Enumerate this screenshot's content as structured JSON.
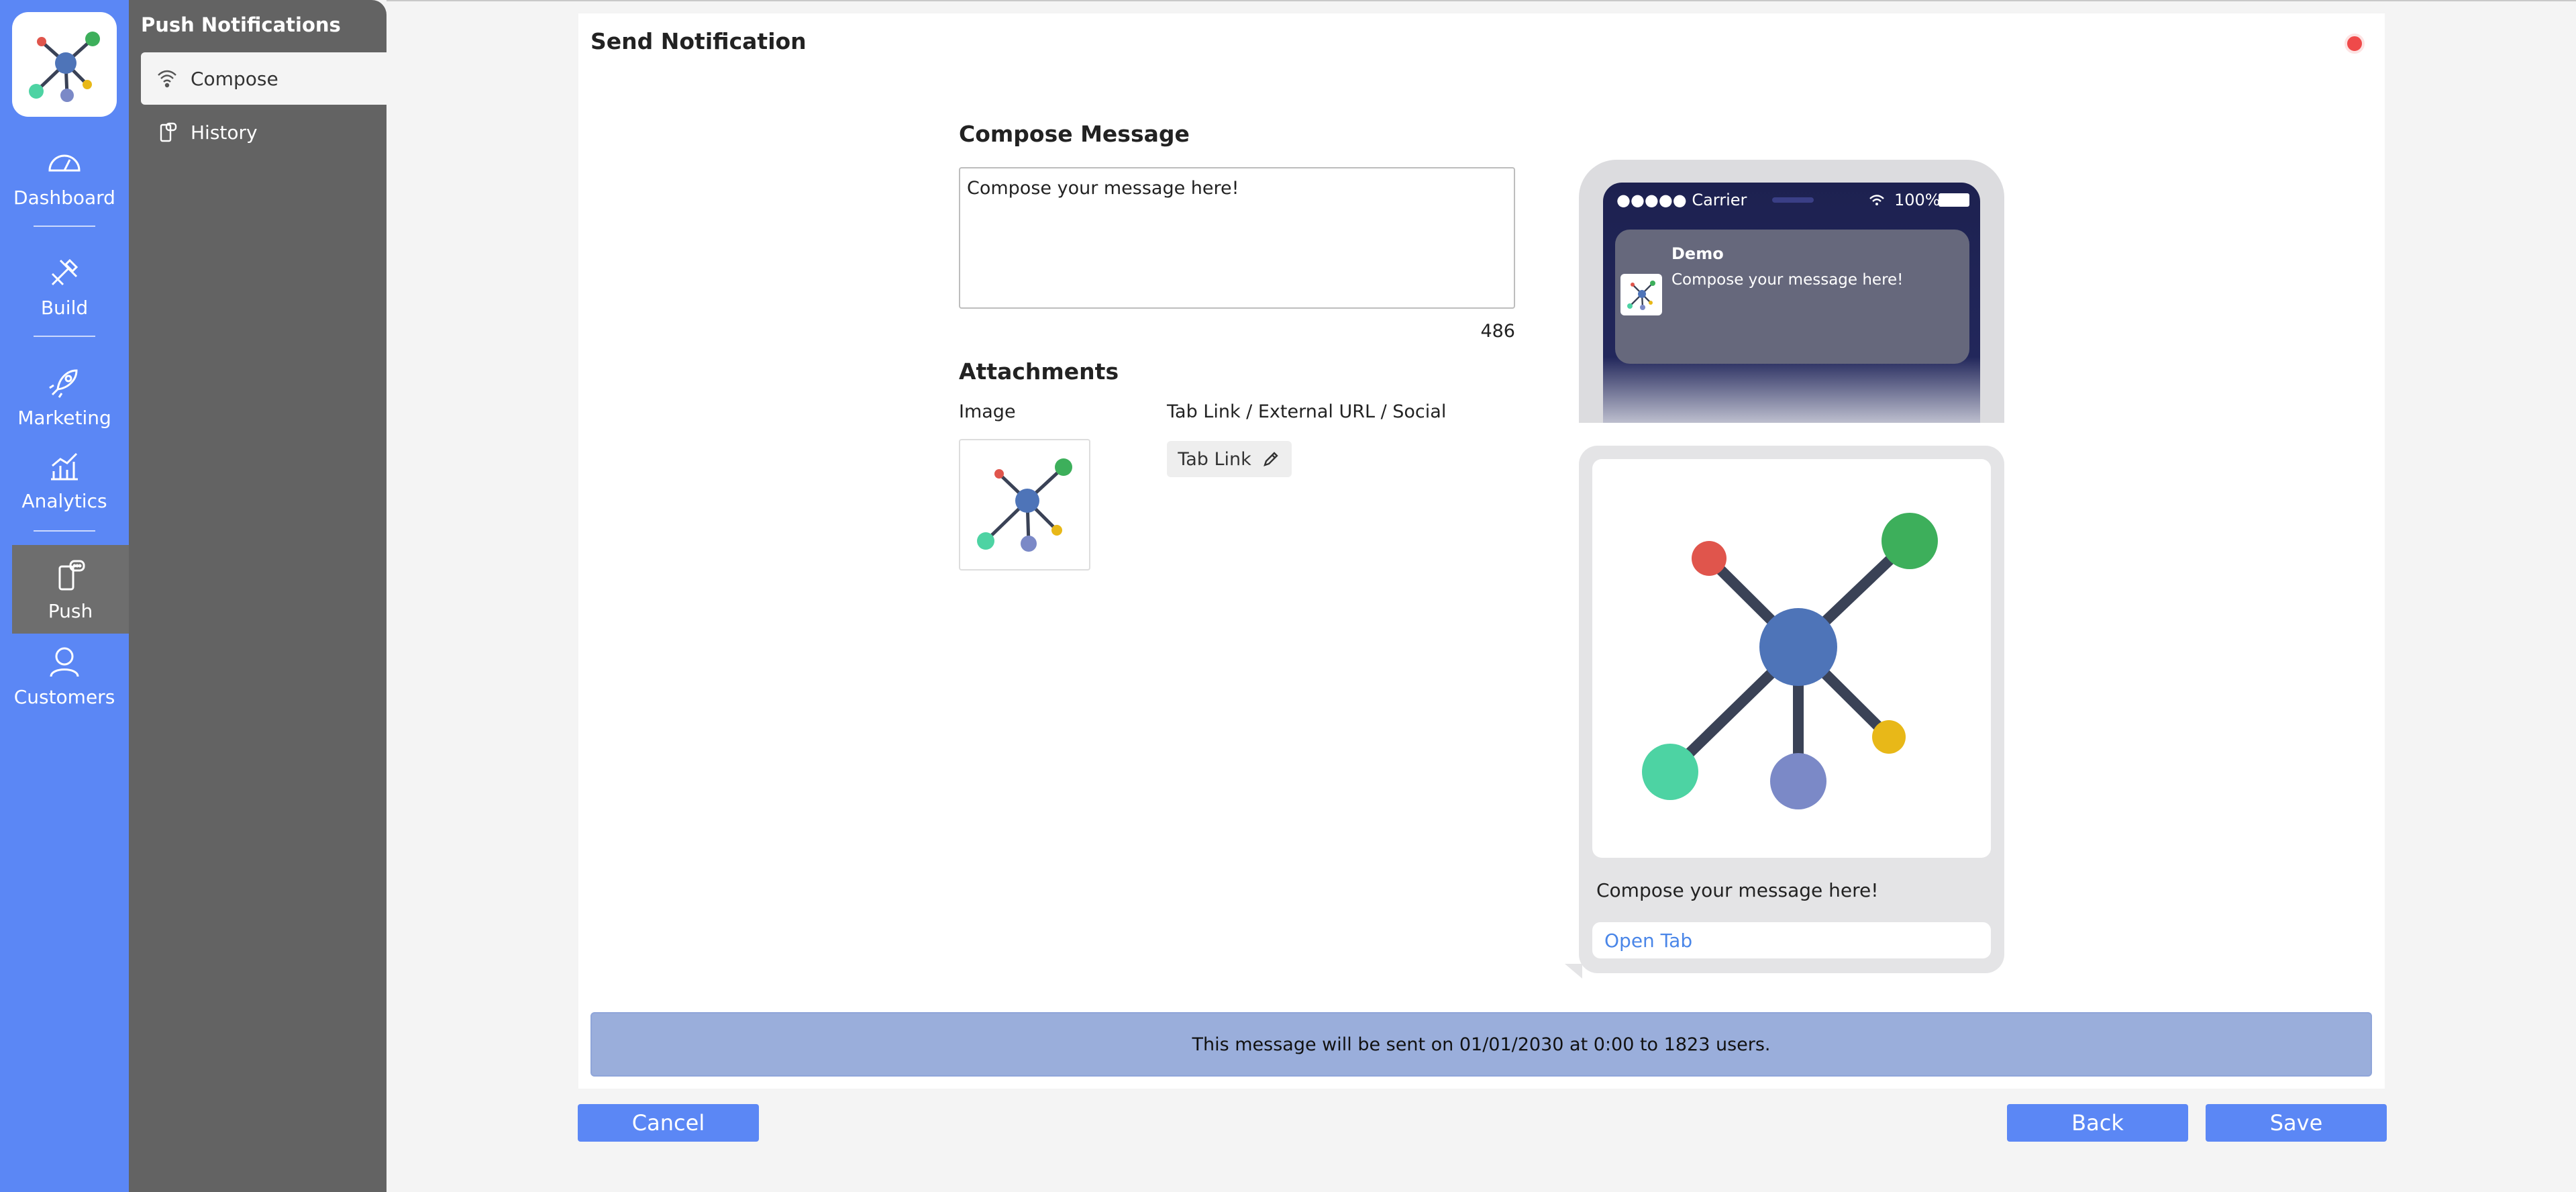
{
  "rail": {
    "items": [
      {
        "label": "Dashboard",
        "icon": "gauge-icon"
      },
      {
        "label": "Build",
        "icon": "tools-icon"
      },
      {
        "label": "Marketing",
        "icon": "rocket-icon"
      },
      {
        "label": "Analytics",
        "icon": "chart-icon"
      },
      {
        "label": "Push",
        "icon": "phone-message-icon"
      },
      {
        "label": "Customers",
        "icon": "person-icon"
      }
    ]
  },
  "subnav": {
    "title": "Push Notifications",
    "items": [
      {
        "label": "Compose",
        "icon": "wifi-icon"
      },
      {
        "label": "History",
        "icon": "history-icon"
      }
    ]
  },
  "card": {
    "title": "Send Notification"
  },
  "compose": {
    "heading": "Compose Message",
    "message": "Compose your message here!",
    "char_count": "486"
  },
  "attachments": {
    "heading": "Attachments",
    "image_label": "Image",
    "link_label": "Tab Link / External URL / Social",
    "link_button": "Tab Link"
  },
  "preview": {
    "carrier": "●●●●● Carrier",
    "battery": "100%",
    "app_name": "Demo",
    "message": "Compose your message here!",
    "open_link": "Open Tab"
  },
  "banner": {
    "text": "This message will be sent on 01/01/2030 at 0:00 to 1823 users."
  },
  "buttons": {
    "cancel": "Cancel",
    "back": "Back",
    "save": "Save"
  },
  "colors": {
    "accent": "#5b87f5",
    "sidebar": "#636363",
    "banner": "#9aaedb"
  }
}
